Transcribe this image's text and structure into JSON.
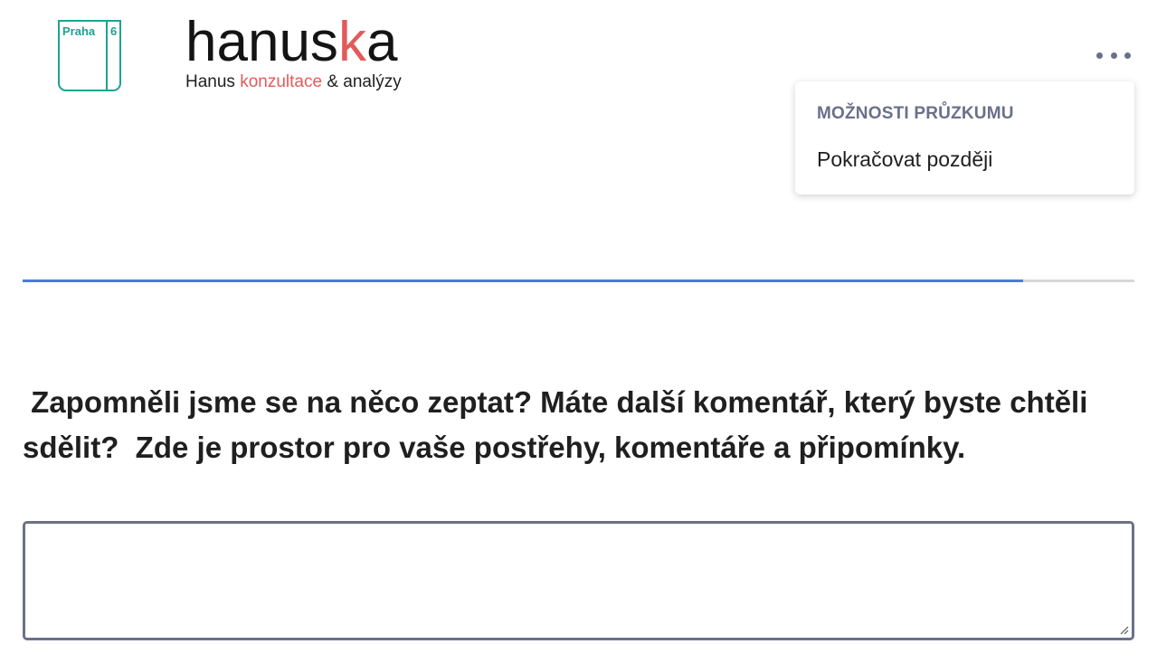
{
  "logo": {
    "district_name": "Praha",
    "district_number": "6"
  },
  "brand": {
    "word_part1": "hanus",
    "word_accent": "k",
    "word_part2": "a",
    "sub_part1": "Hanus ",
    "sub_accent": "konzultace",
    "sub_part2": " & analýzy",
    "accent_color": "#e35a5a"
  },
  "menu": {
    "icon": "more-horizontal-icon",
    "dropdown": {
      "header": "MOŽNOSTI PRŮZKUMU",
      "items": [
        {
          "label": "Pokračovat později"
        }
      ]
    }
  },
  "progress": {
    "value": 0.9,
    "fill_color": "#4c7be0",
    "track_color": "#d7d7d7"
  },
  "question": {
    "text": " Zapomněli jsme se na něco zeptat? Máte další komentář, který byste chtěli sdělit?  Zde je prostor pro vaše postřehy, komentáře a připomínky."
  },
  "answer": {
    "value": "",
    "placeholder": ""
  }
}
